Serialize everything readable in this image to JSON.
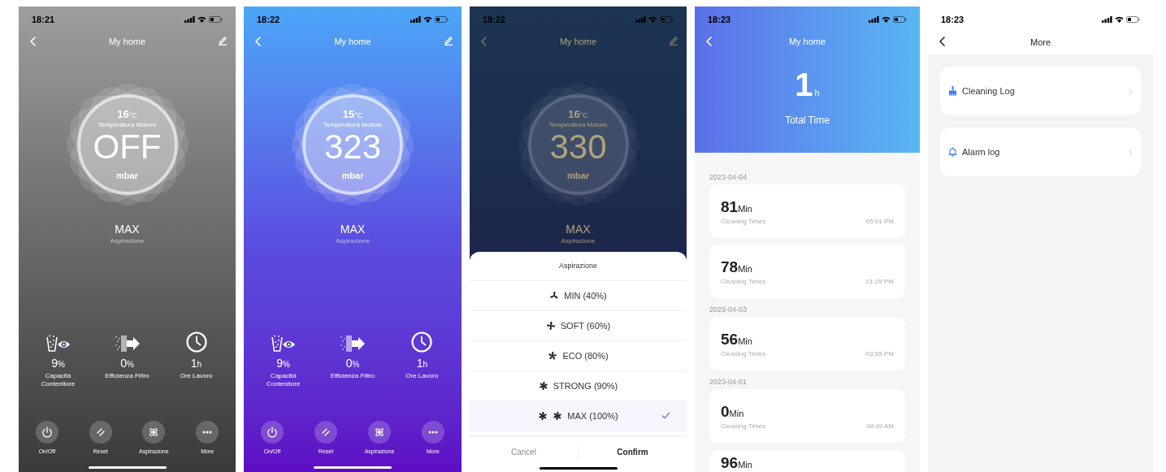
{
  "screens": [
    {
      "kind": "device",
      "on": false,
      "time": "18:21",
      "title": "My home",
      "temperature": "16",
      "temperature_unit": "°C",
      "temperature_label": "Temperatura Motore",
      "reading": "OFF",
      "reading_unit": "mbar",
      "mode": "MAX",
      "mode_label": "Aspirazione",
      "stats": [
        {
          "kind": "container",
          "value": "9",
          "unit": "%",
          "label": "Capacità Contenitore"
        },
        {
          "kind": "filter",
          "value": "0",
          "unit": "%",
          "label": "Efficienza Filtro"
        },
        {
          "kind": "clock",
          "value": "1",
          "unit": "h",
          "label": "Ore Lavoro"
        }
      ],
      "actions": [
        {
          "kind": "power",
          "label": "On/Off"
        },
        {
          "kind": "reset",
          "label": "Reset"
        },
        {
          "kind": "fan",
          "label": "Aspirazione"
        },
        {
          "kind": "more",
          "label": "More"
        }
      ]
    },
    {
      "kind": "device",
      "on": true,
      "time": "18:22",
      "title": "My home",
      "temperature": "15",
      "temperature_unit": "°C",
      "temperature_label": "Temperatura Motore",
      "reading": "323",
      "reading_unit": "mbar",
      "mode": "MAX",
      "mode_label": "Aspirazione",
      "stats": [
        {
          "kind": "container",
          "value": "9",
          "unit": "%",
          "label": "Capacità Contenitore"
        },
        {
          "kind": "filter",
          "value": "0",
          "unit": "%",
          "label": "Efficienza Filtro"
        },
        {
          "kind": "clock",
          "value": "1",
          "unit": "h",
          "label": "Ore Lavoro"
        }
      ],
      "actions": [
        {
          "kind": "power",
          "label": "On/Off"
        },
        {
          "kind": "reset",
          "label": "Reset"
        },
        {
          "kind": "fan",
          "label": "Aspirazione"
        },
        {
          "kind": "more",
          "label": "More"
        }
      ]
    },
    {
      "kind": "picker",
      "time": "18:22",
      "title": "My home",
      "temperature": "16",
      "temperature_unit": "°C",
      "temperature_label": "Temperatura Motore",
      "reading": "330",
      "reading_unit": "mbar",
      "mode": "MAX",
      "mode_label": "Aspirazione",
      "sheet": {
        "title": "Aspirazione",
        "cancel": "Cancel",
        "confirm": "Confirm",
        "options": [
          {
            "kind": "single",
            "label": "MIN (40%)",
            "selected": false
          },
          {
            "kind": "single",
            "label": "SOFT (60%)",
            "selected": false
          },
          {
            "kind": "single",
            "label": "ECO (80%)",
            "selected": false
          },
          {
            "kind": "single",
            "label": "STRONG (90%)",
            "selected": false
          },
          {
            "kind": "double",
            "label": "MAX (100%)",
            "selected": true
          }
        ]
      }
    },
    {
      "kind": "log",
      "time": "18:23",
      "title": "My home",
      "total": "1",
      "total_unit": "h",
      "total_label": "Total Time",
      "groups": [
        {
          "date": "2023-04-04",
          "entries": [
            {
              "value": "81",
              "unit": "Min",
              "label": "Cleaning Times",
              "time": "05:01 PM"
            },
            {
              "value": "78",
              "unit": "Min",
              "label": "Cleaning Times",
              "time": "01:29 PM"
            }
          ]
        },
        {
          "date": "2023-04-03",
          "entries": [
            {
              "value": "56",
              "unit": "Min",
              "label": "Cleaning Times",
              "time": "03:55 PM"
            }
          ]
        },
        {
          "date": "2023-04-01",
          "entries": [
            {
              "value": "0",
              "unit": "Min",
              "label": "Cleaning Times",
              "time": "08:49 AM"
            },
            {
              "value": "96",
              "unit": "Min"
            }
          ]
        }
      ]
    },
    {
      "kind": "more",
      "time": "18:23",
      "title": "More",
      "items": [
        {
          "kind": "broom",
          "label": "Cleaning Log"
        },
        {
          "kind": "bell",
          "label": "Alarm log"
        }
      ]
    }
  ]
}
